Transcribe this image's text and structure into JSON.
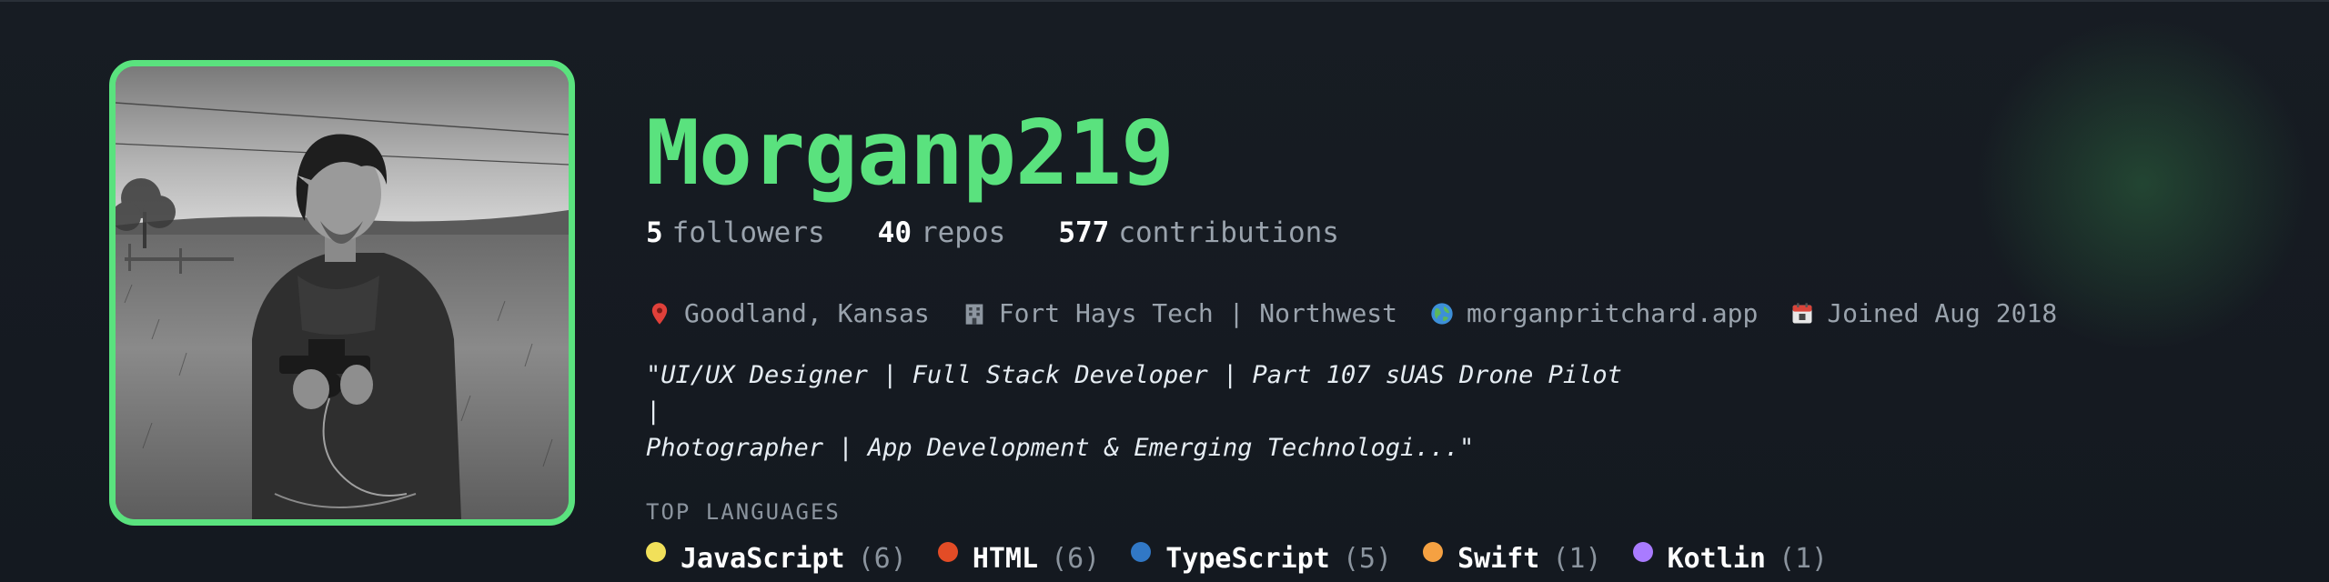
{
  "profile": {
    "username": "Morganp219",
    "avatar_alt": "Profile photo"
  },
  "stats": {
    "followers": {
      "value": "5",
      "label": "followers"
    },
    "repos": {
      "value": "40",
      "label": "repos"
    },
    "contributions": {
      "value": "577",
      "label": "contributions"
    }
  },
  "meta": {
    "location": "Goodland, Kansas",
    "company": "Fort Hays Tech | Northwest",
    "website": "morganpritchard.app",
    "joined": "Joined Aug 2018"
  },
  "bio": {
    "line1": "\"UI/UX Designer | Full Stack Developer | Part 107 sUAS Drone Pilot |",
    "line2": "Photographer | App Development & Emerging Technologi...\""
  },
  "languages": {
    "title": "TOP LANGUAGES",
    "items": [
      {
        "name": "JavaScript",
        "count": "(6)",
        "color": "#f1e05a"
      },
      {
        "name": "HTML",
        "count": "(6)",
        "color": "#e34c26"
      },
      {
        "name": "TypeScript",
        "count": "(5)",
        "color": "#3178c6"
      },
      {
        "name": "Swift",
        "count": "(1)",
        "color": "#f5a142"
      },
      {
        "name": "Kotlin",
        "count": "(1)",
        "color": "#a97bff"
      }
    ]
  },
  "colors": {
    "accent": "#5ae27e",
    "background": "#151a21"
  }
}
